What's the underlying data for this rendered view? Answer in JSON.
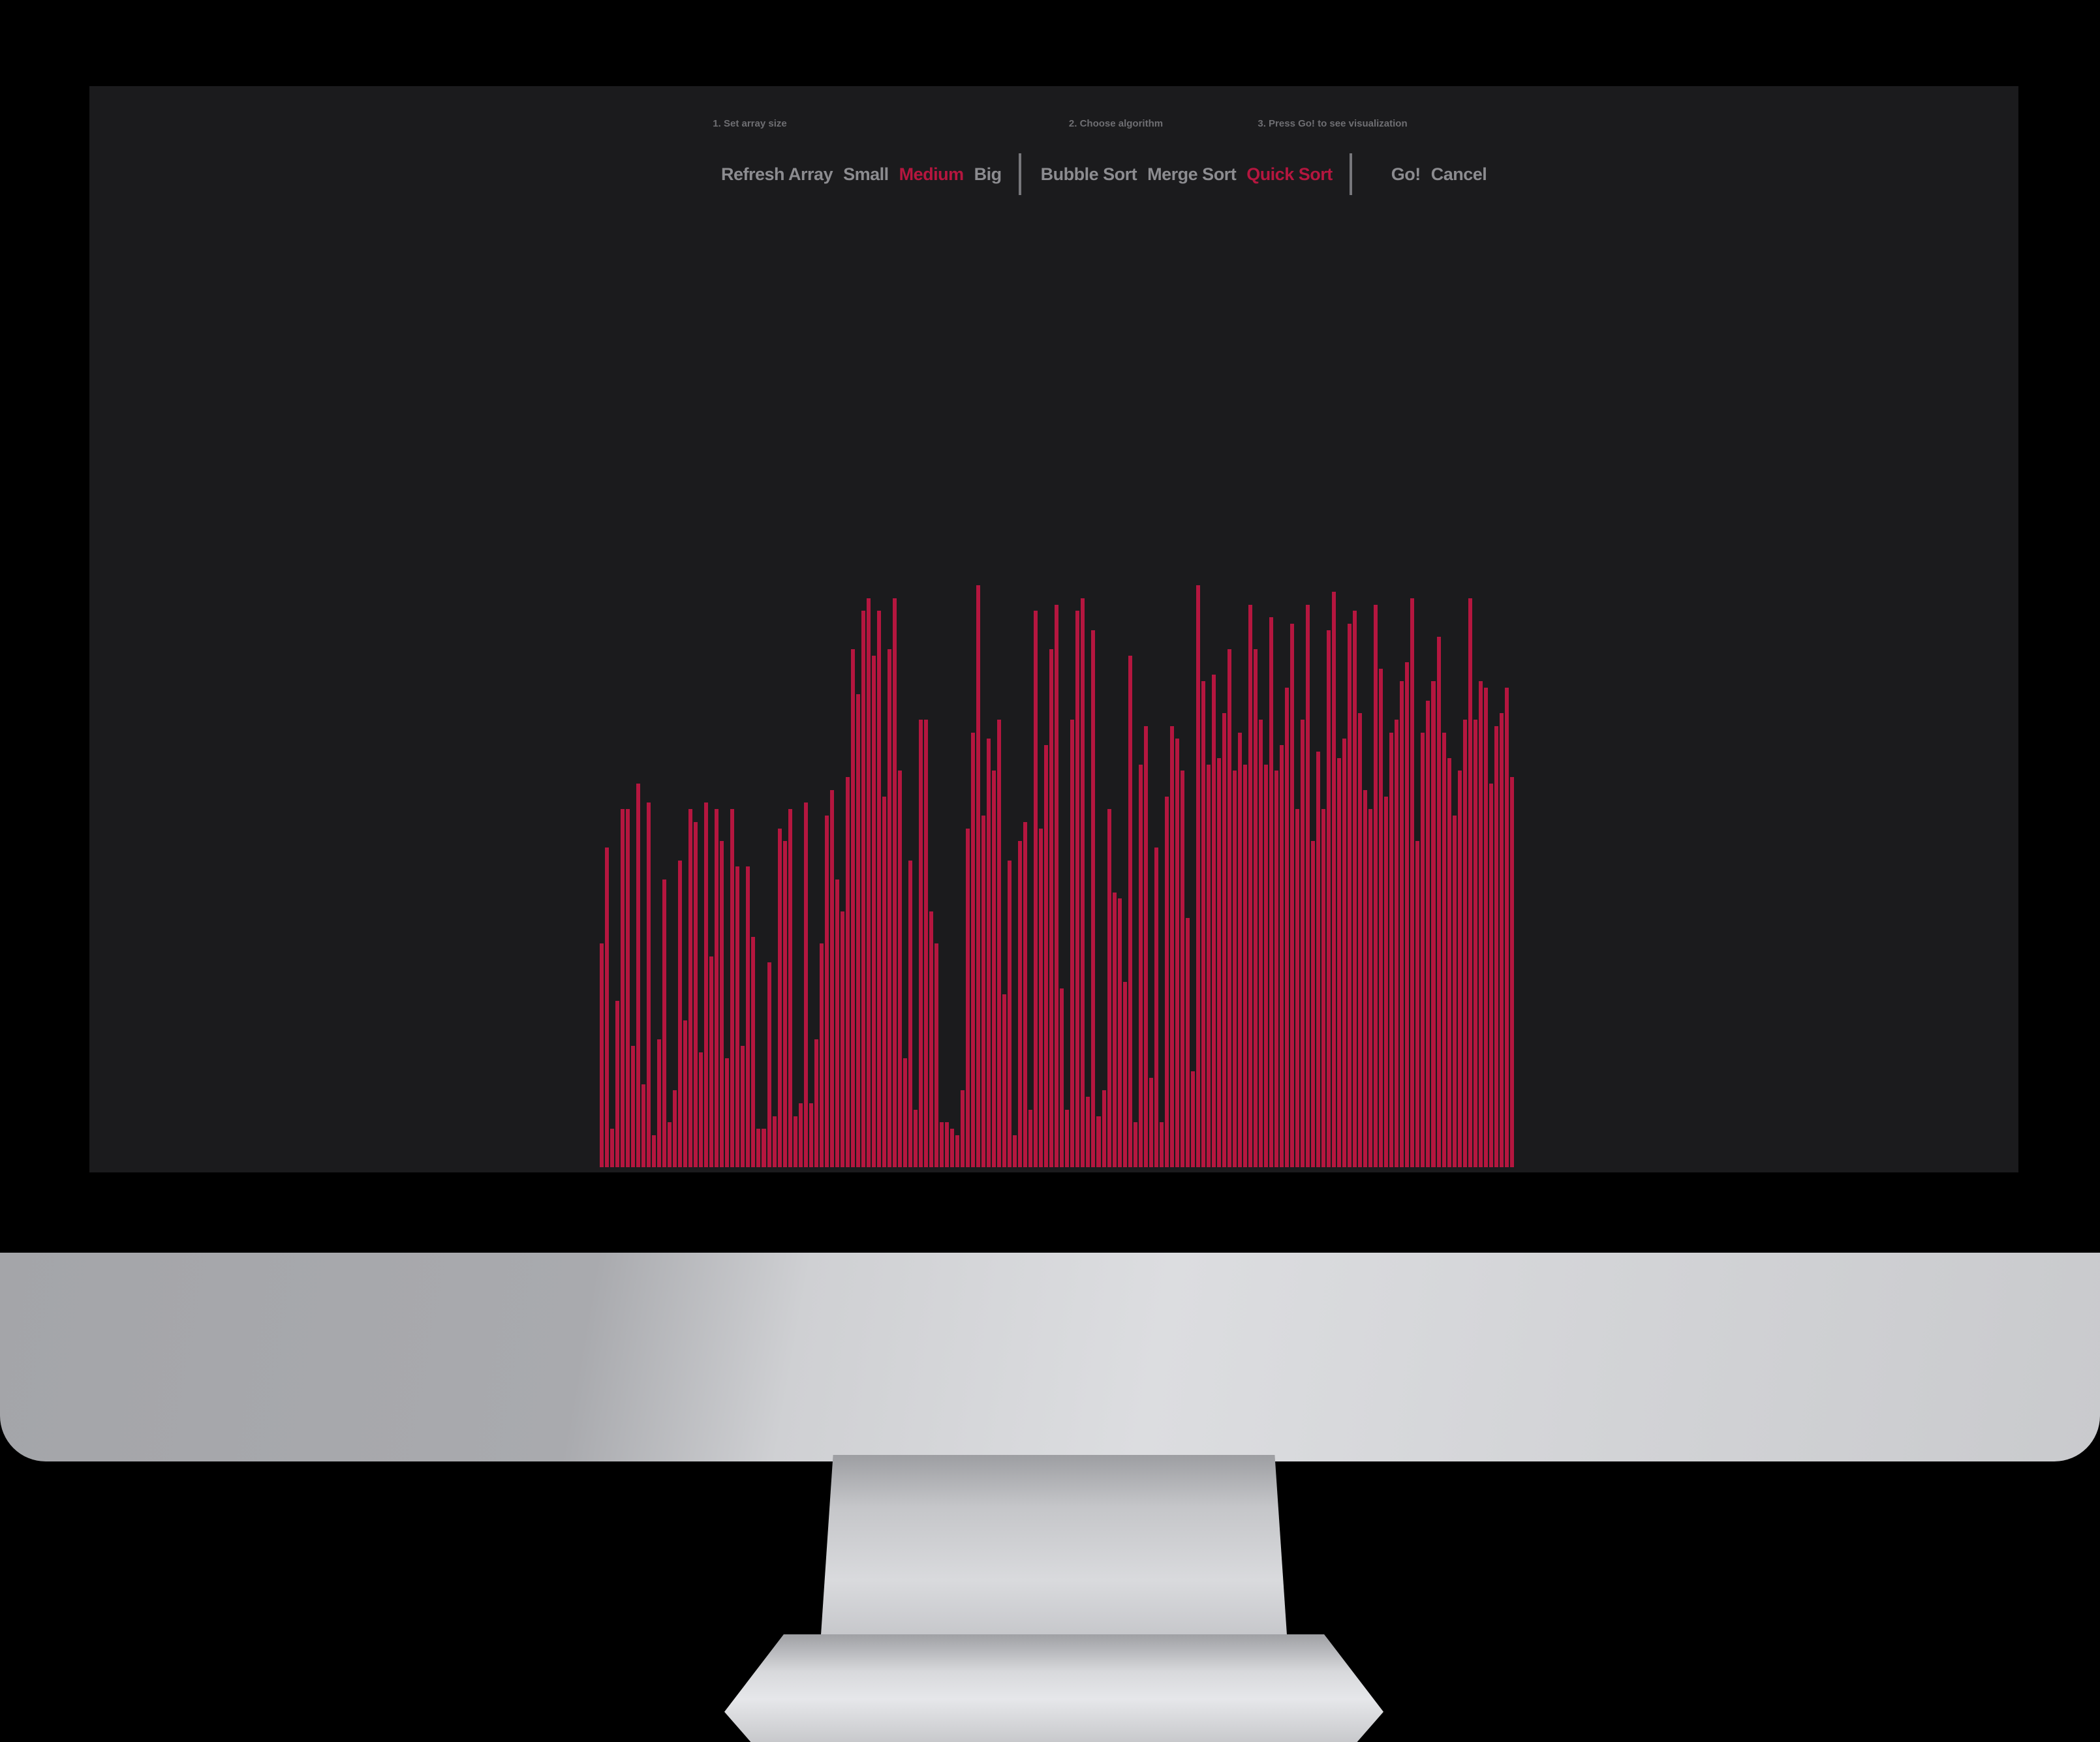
{
  "steps": {
    "step1": "1. Set array size",
    "step2": "2. Choose algorithm",
    "step3": "3. Press Go! to see visualization"
  },
  "size_controls": {
    "refresh": "Refresh Array",
    "small": "Small",
    "medium": "Medium",
    "big": "Big",
    "selected": "Medium"
  },
  "algorithm_controls": {
    "bubble": "Bubble Sort",
    "merge": "Merge Sort",
    "quick": "Quick Sort",
    "selected": "Quick Sort"
  },
  "action_controls": {
    "go": "Go!",
    "cancel": "Cancel"
  },
  "colors": {
    "accent": "#b5163f",
    "button_text": "#8c8c90",
    "screen_background": "#1b1b1d"
  },
  "array_values": [
    35,
    50,
    6,
    26,
    56,
    56,
    19,
    60,
    13,
    57,
    5,
    20,
    45,
    7,
    12,
    48,
    23,
    56,
    54,
    18,
    57,
    33,
    56,
    51,
    17,
    56,
    47,
    19,
    47,
    36,
    6,
    6,
    32,
    8,
    53,
    51,
    56,
    8,
    10,
    57,
    10,
    20,
    35,
    55,
    59,
    45,
    40,
    61,
    81,
    74,
    87,
    89,
    80,
    87,
    58,
    81,
    89,
    62,
    17,
    48,
    9,
    70,
    70,
    40,
    35,
    7,
    7,
    6,
    5,
    12,
    53,
    68,
    91,
    55,
    67,
    62,
    70,
    27,
    48,
    5,
    51,
    54,
    9,
    87,
    53,
    66,
    81,
    88,
    28,
    9,
    70,
    87,
    89,
    11,
    84,
    8,
    12,
    56,
    43,
    42,
    29,
    80,
    7,
    63,
    69,
    14,
    50,
    7,
    58,
    69,
    67,
    62,
    39,
    15,
    91,
    76,
    63,
    77,
    64,
    71,
    81,
    62,
    68,
    63,
    88,
    81,
    70,
    63,
    86,
    62,
    66,
    75,
    85,
    56,
    70,
    88,
    51,
    65,
    56,
    84,
    90,
    64,
    67,
    85,
    87,
    71,
    59,
    56,
    88,
    78,
    58,
    68,
    70,
    76,
    79,
    89,
    51,
    68,
    73,
    76,
    83,
    68,
    64,
    55,
    62,
    70,
    89,
    70,
    76,
    75,
    60,
    69,
    71,
    75,
    61
  ]
}
